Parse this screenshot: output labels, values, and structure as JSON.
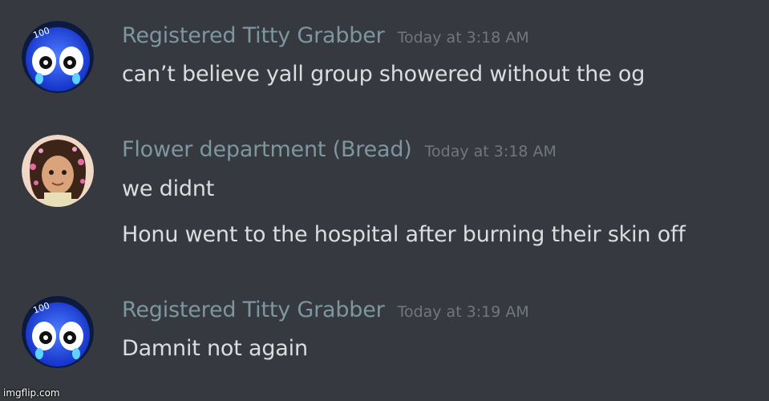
{
  "messages": [
    {
      "author": "Registered Titty Grabber",
      "timestamp": "Today at 3:18 AM",
      "avatar": "blue-emoji-avatar",
      "lines": [
        "can’t believe yall group showered without the og"
      ]
    },
    {
      "author": "Flower department (Bread)",
      "timestamp": "Today at 3:18 AM",
      "avatar": "cartoon-character-avatar",
      "lines": [
        "we didnt",
        "Honu went to the hospital after burning their skin off"
      ]
    },
    {
      "author": "Registered Titty Grabber",
      "timestamp": "Today at 3:19 AM",
      "avatar": "blue-emoji-avatar",
      "lines": [
        "Damnit not again"
      ]
    }
  ],
  "watermark": "imgflip.com"
}
